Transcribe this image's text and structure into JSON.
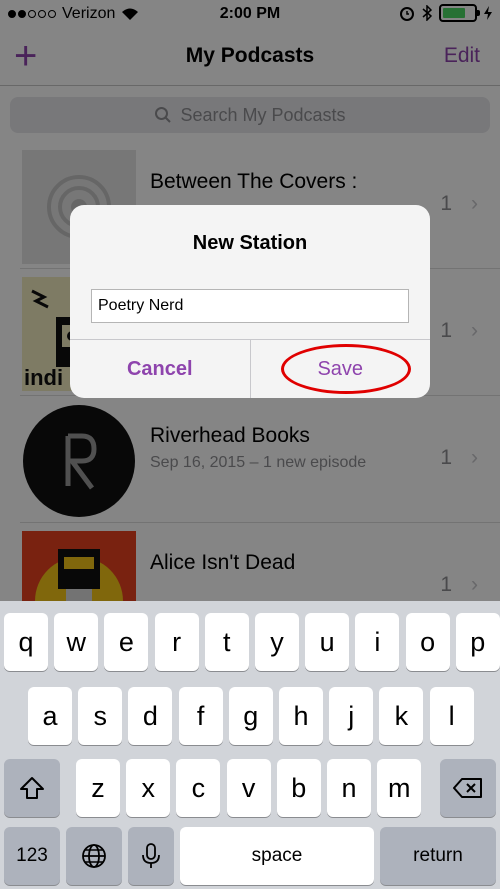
{
  "status": {
    "carrier": "Verizon",
    "time": "2:00 PM"
  },
  "nav": {
    "title": "My Podcasts",
    "add": "+",
    "edit": "Edit"
  },
  "search": {
    "placeholder": "Search My Podcasts"
  },
  "podcasts": [
    {
      "title": "Between The Covers :",
      "subtitle": "",
      "count": "1"
    },
    {
      "title": "",
      "subtitle": "",
      "count": "1",
      "art_text": "indi"
    },
    {
      "title": "Riverhead Books",
      "subtitle": "Sep 16, 2015 – 1 new episode",
      "count": "1"
    },
    {
      "title": "Alice Isn't Dead",
      "subtitle": "",
      "count": "1"
    }
  ],
  "alert": {
    "title": "New Station",
    "input_value": "Poetry Nerd",
    "cancel": "Cancel",
    "save": "Save"
  },
  "keyboard": {
    "row1": [
      "q",
      "w",
      "e",
      "r",
      "t",
      "y",
      "u",
      "i",
      "o",
      "p"
    ],
    "row2": [
      "a",
      "s",
      "d",
      "f",
      "g",
      "h",
      "j",
      "k",
      "l"
    ],
    "row3": [
      "z",
      "x",
      "c",
      "v",
      "b",
      "n",
      "m"
    ],
    "numbers": "123",
    "space": "space",
    "return": "return"
  },
  "colors": {
    "accent": "#8e44ad",
    "highlight": "#e00000",
    "battery": "#4cd964"
  }
}
